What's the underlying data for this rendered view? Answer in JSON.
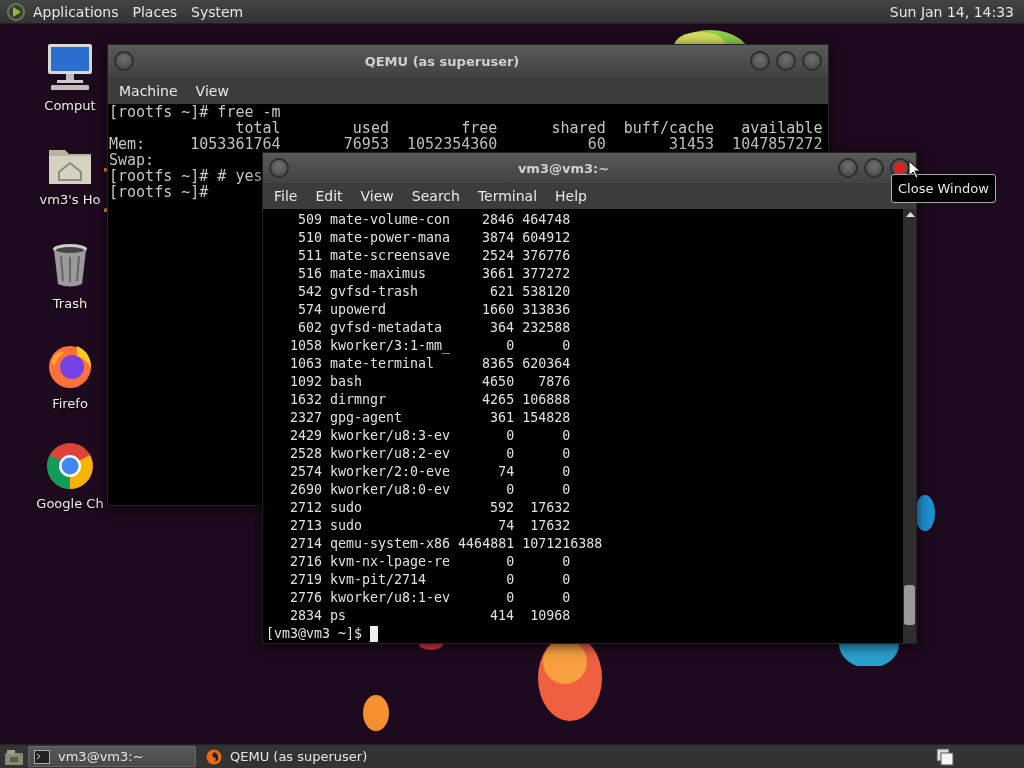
{
  "top_panel": {
    "menus": [
      "Applications",
      "Places",
      "System"
    ],
    "clock": "Sun Jan 14, 14:33"
  },
  "desktop_icons": [
    {
      "label": "Comput",
      "kind": "computer"
    },
    {
      "label": "vm3's Ho",
      "kind": "home"
    },
    {
      "label": "Trash",
      "kind": "trash"
    },
    {
      "label": "Firefo",
      "kind": "firefox"
    },
    {
      "label": "Google Ch",
      "kind": "chrome"
    }
  ],
  "qemu_window": {
    "title": "QEMU (as superuser)",
    "menus": [
      "Machine",
      "View"
    ],
    "console_lines": [
      "[rootfs ~]# free -m",
      "              total        used        free      shared  buff/cache   available",
      "Mem:     1053361764       76953  1052354360          60       31453  1047857272",
      "Swap:",
      "[rootfs ~]# # yes",
      "[rootfs ~]#"
    ]
  },
  "terminal_window": {
    "title": "vm3@vm3:~",
    "close_hovered": true,
    "menus": [
      "File",
      "Edit",
      "View",
      "Search",
      "Terminal",
      "Help"
    ],
    "processes": [
      {
        "pid": "509",
        "command": "mate-volume-con",
        "rss": "2846",
        "vsz": "464748"
      },
      {
        "pid": "510",
        "command": "mate-power-mana",
        "rss": "3874",
        "vsz": "604912"
      },
      {
        "pid": "511",
        "command": "mate-screensave",
        "rss": "2524",
        "vsz": "376776"
      },
      {
        "pid": "516",
        "command": "mate-maximus",
        "rss": "3661",
        "vsz": "377272"
      },
      {
        "pid": "542",
        "command": "gvfsd-trash",
        "rss": "621",
        "vsz": "538120"
      },
      {
        "pid": "574",
        "command": "upowerd",
        "rss": "1660",
        "vsz": "313836"
      },
      {
        "pid": "602",
        "command": "gvfsd-metadata",
        "rss": "364",
        "vsz": "232588"
      },
      {
        "pid": "1058",
        "command": "kworker/3:1-mm_",
        "rss": "0",
        "vsz": "0"
      },
      {
        "pid": "1063",
        "command": "mate-terminal",
        "rss": "8365",
        "vsz": "620364"
      },
      {
        "pid": "1092",
        "command": "bash",
        "rss": "4650",
        "vsz": "7876"
      },
      {
        "pid": "1632",
        "command": "dirmngr",
        "rss": "4265",
        "vsz": "106888"
      },
      {
        "pid": "2327",
        "command": "gpg-agent",
        "rss": "361",
        "vsz": "154828"
      },
      {
        "pid": "2429",
        "command": "kworker/u8:3-ev",
        "rss": "0",
        "vsz": "0"
      },
      {
        "pid": "2528",
        "command": "kworker/u8:2-ev",
        "rss": "0",
        "vsz": "0"
      },
      {
        "pid": "2574",
        "command": "kworker/2:0-eve",
        "rss": "74",
        "vsz": "0"
      },
      {
        "pid": "2690",
        "command": "kworker/u8:0-ev",
        "rss": "0",
        "vsz": "0"
      },
      {
        "pid": "2712",
        "command": "sudo",
        "rss": "592",
        "vsz": "17632"
      },
      {
        "pid": "2713",
        "command": "sudo",
        "rss": "74",
        "vsz": "17632"
      },
      {
        "pid": "2714",
        "command": "qemu-system-x86",
        "rss": "4464881",
        "vsz": "1071216388"
      },
      {
        "pid": "2716",
        "command": "kvm-nx-lpage-re",
        "rss": "0",
        "vsz": "0"
      },
      {
        "pid": "2719",
        "command": "kvm-pit/2714",
        "rss": "0",
        "vsz": "0"
      },
      {
        "pid": "2776",
        "command": "kworker/u8:1-ev",
        "rss": "0",
        "vsz": "0"
      },
      {
        "pid": "2834",
        "command": "ps",
        "rss": "414",
        "vsz": "10968"
      }
    ],
    "prompt": "[vm3@vm3 ~]$"
  },
  "tooltip": "Close Window",
  "taskbar": {
    "tasks": [
      {
        "label": "vm3@vm3:~",
        "kind": "terminal",
        "selected": true
      },
      {
        "label": "QEMU (as superuser)",
        "kind": "qemu",
        "selected": false
      }
    ]
  }
}
